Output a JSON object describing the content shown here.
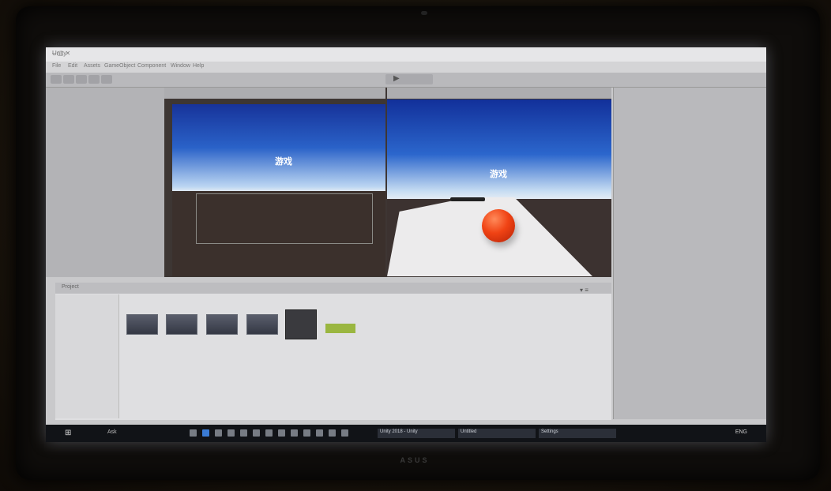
{
  "window": {
    "title": "Unity",
    "controls": "– ▢ ✕"
  },
  "menu": [
    "File",
    "Edit",
    "Assets",
    "GameObject",
    "Component",
    "Window",
    "Help"
  ],
  "toolbar": {
    "play_symbol": "▶"
  },
  "panels": {
    "hierarchy_tab": "",
    "scene_tab": "",
    "game_tab": "",
    "inspector_tab": ""
  },
  "scene": {
    "overlay_text": "游戏"
  },
  "game": {
    "overlay_text": "游戏"
  },
  "project": {
    "tab": "Project",
    "header_icons": "▾ ≡",
    "tree": [
      "",
      "",
      "",
      ""
    ],
    "assets": [
      {
        "name": "",
        "kind": "scene"
      },
      {
        "name": "",
        "kind": "scene"
      },
      {
        "name": "",
        "kind": "scene"
      },
      {
        "name": "",
        "kind": "scene"
      },
      {
        "name": "",
        "kind": "dark"
      },
      {
        "name": "",
        "kind": "green"
      }
    ]
  },
  "taskbar": {
    "start": "⊞",
    "search": "Ask",
    "tasks": [
      "Unity 2018 - Unity",
      "Untitled",
      "Settings"
    ],
    "tray": "ENG"
  },
  "device": {
    "brand": "ASUS"
  }
}
